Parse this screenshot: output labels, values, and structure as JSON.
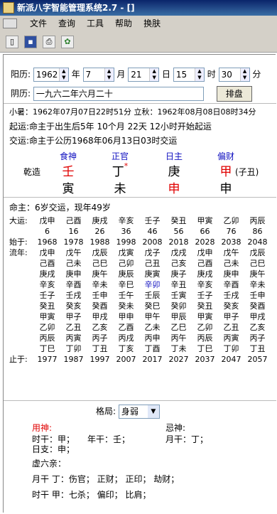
{
  "window": {
    "title": "新派八字智能管理系统2.7 - []"
  },
  "menu": [
    "文件",
    "查询",
    "工具",
    "帮助",
    "换肤"
  ],
  "toolbar": {
    "icons": [
      "new-doc-icon",
      "save-icon",
      "print-icon",
      "tools-icon"
    ]
  },
  "form": {
    "solar_label": "阳历:",
    "year": "1962",
    "year_unit": "年",
    "month": "7",
    "month_unit": "月",
    "day": "21",
    "day_unit": "日",
    "hour": "15",
    "hour_unit": "时",
    "minute": "30",
    "minute_unit": "分",
    "lunar_label": "阴历:",
    "lunar_value": "一九六二年六月二十",
    "submit": "排盘"
  },
  "info": {
    "line1": "小暑：1962年07月07日22时51分 立秋：1962年08月08日08时34分",
    "line2": "起运:命主于出生后5年 10个月 22天 12小时开始起运",
    "line3": "交运:命主于公历1968年06月13日03时交运"
  },
  "chart": {
    "row_label": "乾造",
    "gods": [
      "食神",
      "正官",
      "日主",
      "偏财"
    ],
    "stems": [
      "壬",
      "丁",
      "庚",
      "甲"
    ],
    "branches": [
      "寅",
      "未",
      "申",
      "申"
    ],
    "star": "*",
    "void": "(子丑)"
  },
  "age": "命主：6岁交运，现年49岁",
  "dayun": {
    "label": "大运:",
    "pillars": [
      "戊申",
      "己酉",
      "庚戌",
      "辛亥",
      "壬子",
      "癸丑",
      "甲寅",
      "乙卯",
      "丙辰"
    ],
    "ages": [
      "6",
      "16",
      "26",
      "36",
      "46",
      "56",
      "66",
      "76",
      "86"
    ],
    "start_label": "始于:",
    "start_years": [
      "1968",
      "1978",
      "1988",
      "1998",
      "2008",
      "2018",
      "2028",
      "2038",
      "2048"
    ],
    "liunian_label": "流年:",
    "liunian": [
      [
        "戊申",
        "戊午",
        "戊辰",
        "戊寅",
        "戊子",
        "戊戌",
        "戊申",
        "戊午",
        "戊辰"
      ],
      [
        "己酉",
        "己未",
        "己巳",
        "己卯",
        "己丑",
        "己亥",
        "己酉",
        "己未",
        "己巳"
      ],
      [
        "庚戌",
        "庚申",
        "庚午",
        "庚辰",
        "庚寅",
        "庚子",
        "庚戌",
        "庚申",
        "庚午"
      ],
      [
        "辛亥",
        "辛酉",
        "辛未",
        "辛巳",
        "辛卯",
        "辛丑",
        "辛亥",
        "辛酉",
        "辛未"
      ],
      [
        "壬子",
        "壬戌",
        "壬申",
        "壬午",
        "壬辰",
        "壬寅",
        "壬子",
        "壬戌",
        "壬申"
      ],
      [
        "癸丑",
        "癸亥",
        "癸酉",
        "癸未",
        "癸巳",
        "癸卯",
        "癸丑",
        "癸亥",
        "癸酉"
      ],
      [
        "甲寅",
        "甲子",
        "甲戌",
        "甲申",
        "甲午",
        "甲辰",
        "甲寅",
        "甲子",
        "甲戌"
      ],
      [
        "乙卯",
        "乙丑",
        "乙亥",
        "乙酉",
        "乙未",
        "乙巳",
        "乙卯",
        "乙丑",
        "乙亥"
      ],
      [
        "丙辰",
        "丙寅",
        "丙子",
        "丙戌",
        "丙申",
        "丙午",
        "丙辰",
        "丙寅",
        "丙子"
      ],
      [
        "丁巳",
        "丁卯",
        "丁丑",
        "丁亥",
        "丁酉",
        "丁未",
        "丁巳",
        "丁卯",
        "丁丑"
      ]
    ],
    "end_label": "止于:",
    "end_years": [
      "1977",
      "1987",
      "1997",
      "2007",
      "2017",
      "2027",
      "2037",
      "2047",
      "2057"
    ]
  },
  "analysis": {
    "geju_label": "格局:",
    "geju_value": "身弱",
    "yongshen_label": "用神:",
    "jishen_label": "忌神:",
    "shigan": "时干：甲；",
    "niangan": "年干：壬；",
    "yuegan": "月干：丁；",
    "rizhi": "日支：申；",
    "xuliuqin": "虚六亲：",
    "line_a": "月干 丁：伤官；  正财；  正印；  劫财；",
    "line_b": "时干 甲：七杀；  偏印；  比肩；"
  },
  "colors": {
    "red": "#e00000",
    "blue": "#1010c0",
    "titlebar": "#0a246a"
  }
}
